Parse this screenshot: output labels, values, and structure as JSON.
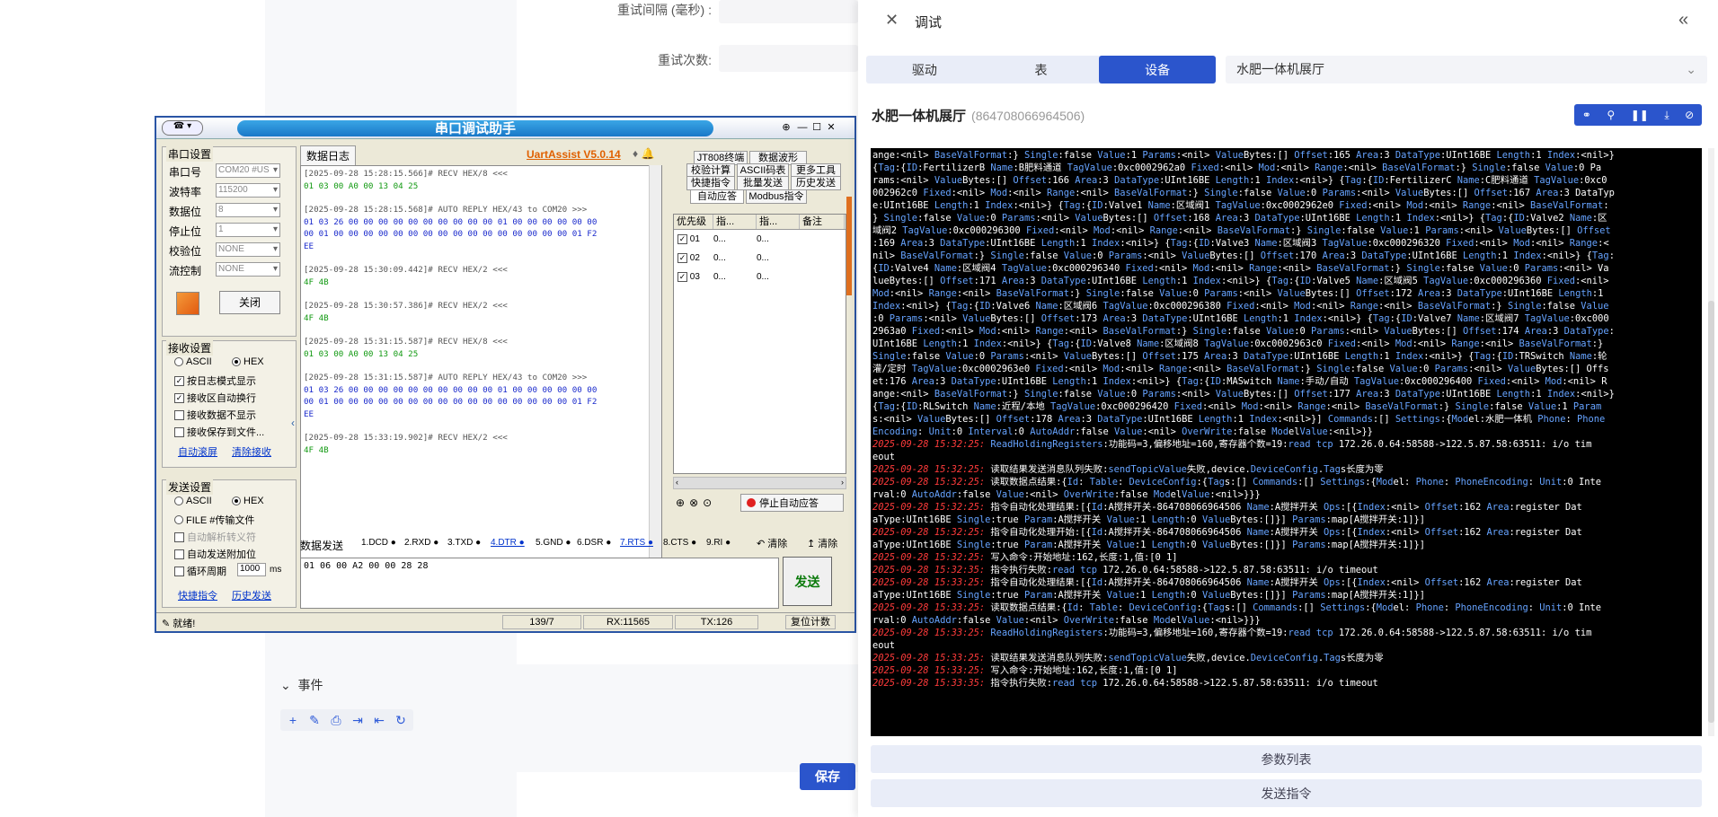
{
  "bg": {
    "retry_interval_label": "重试间隔 (毫秒) :",
    "retry_count_label": "重试次数:",
    "events_title": "事件",
    "save_label": "保存"
  },
  "serial": {
    "title": "串口调试助手",
    "version": "UartAssist V5.0.14",
    "port_group": "串口设置",
    "port_label": "串口号",
    "port_value": "COM20 #US",
    "baud_label": "波特率",
    "baud_value": "115200",
    "databits_label": "数据位",
    "databits_value": "8",
    "stopbits_label": "停止位",
    "stopbits_value": "1",
    "parity_label": "校验位",
    "parity_value": "NONE",
    "flow_label": "流控制",
    "flow_value": "NONE",
    "close_label": "关闭",
    "recv_group": "接收设置",
    "ascii": "ASCII",
    "hex": "HEX",
    "recv_opt1": "按日志模式显示",
    "recv_opt2": "接收区自动换行",
    "recv_opt3": "接收数据不显示",
    "recv_opt4": "接收保存到文件...",
    "auto_scroll": "自动滚屏",
    "clear_recv": "清除接收",
    "send_group": "发送设置",
    "file_send": "FILE #传输文件",
    "auto_parse": "自动解析转义符",
    "send_opt1": "自动发送附加位",
    "send_opt2": "循环周期",
    "period_value": "1000",
    "ms": "ms",
    "quick_cmd": "快捷指令",
    "history_send": "历史发送",
    "log_tab": "数据日志",
    "send_tab": "数据发送",
    "log_lines": [
      {
        "t": "h",
        "s": "[2025-09-28 15:28:15.566]# RECV HEX/8 <<<"
      },
      {
        "t": "g",
        "s": "01 03 00 A0 00 13 04 25"
      },
      {
        "t": "gap",
        "s": ""
      },
      {
        "t": "h",
        "s": "[2025-09-28 15:28:15.568]# AUTO REPLY HEX/43 to COM20 >>>"
      },
      {
        "t": "b",
        "s": "01 03 26 00 00 00 00 00 00 00 00 00 00 01 00 00 00 00 00 00"
      },
      {
        "t": "b",
        "s": "00 01 00 00 00 00 00 00 00 00 00 00 00 00 00 00 00 00 01 F2"
      },
      {
        "t": "b",
        "s": "EE"
      },
      {
        "t": "gap",
        "s": ""
      },
      {
        "t": "h",
        "s": "[2025-09-28 15:30:09.442]# RECV HEX/2 <<<"
      },
      {
        "t": "g",
        "s": "4F 4B"
      },
      {
        "t": "gap",
        "s": ""
      },
      {
        "t": "h",
        "s": "[2025-09-28 15:30:57.386]# RECV HEX/2 <<<"
      },
      {
        "t": "g",
        "s": "4F 4B"
      },
      {
        "t": "gap",
        "s": ""
      },
      {
        "t": "h",
        "s": "[2025-09-28 15:31:15.587]# RECV HEX/8 <<<"
      },
      {
        "t": "g",
        "s": "01 03 00 A0 00 13 04 25"
      },
      {
        "t": "gap",
        "s": ""
      },
      {
        "t": "h",
        "s": "[2025-09-28 15:31:15.587]# AUTO REPLY HEX/43 to COM20 >>>"
      },
      {
        "t": "b",
        "s": "01 03 26 00 00 00 00 00 00 00 00 00 00 01 00 00 00 00 00 00"
      },
      {
        "t": "b",
        "s": "00 01 00 00 00 00 00 00 00 00 00 00 00 00 00 00 00 00 01 F2"
      },
      {
        "t": "b",
        "s": "EE"
      },
      {
        "t": "gap",
        "s": ""
      },
      {
        "t": "h",
        "s": "[2025-09-28 15:33:19.902]# RECV HEX/2 <<<"
      },
      {
        "t": "g",
        "s": "4F 4B"
      }
    ],
    "rtabs": [
      "JT808终端",
      "数据波形",
      "校验计算",
      "ASCII码表",
      "更多工具",
      "快捷指令",
      "批量发送",
      "历史发送",
      "自动应答",
      "Modbus指令"
    ],
    "grid_headers": [
      "优先级",
      "指...",
      "指...",
      "备注"
    ],
    "grid_rows": [
      "01",
      "02",
      "03"
    ],
    "grid_cell": "0...",
    "stop_reply": "停止自动应答",
    "signals": [
      "1.DCD",
      "2.RXD",
      "3.TXD",
      "4.DTR",
      "5.GND",
      "6.DSR",
      "7.RTS",
      "8.CTS",
      "9.RI"
    ],
    "clear1": "清除",
    "clear2": "清除",
    "send_text": "01 06 00 A2 00 00 28 28",
    "send_btn": "发送",
    "status_ready": "就绪!",
    "status_pos": "139/7",
    "status_rx": "RX:11565",
    "status_tx": "TX:126",
    "reset_count": "复位计数"
  },
  "panel": {
    "title": "调试",
    "tabs": [
      "驱动",
      "表",
      "设备"
    ],
    "device_select": "水肥一体机展厅",
    "device_name": "水肥一体机展厅",
    "device_id": "864708066964506",
    "params_btn": "参数列表",
    "send_btn": "发送指令",
    "term_lines": [
      "ange:<nil> BaseValFormat:} Single:false Value:1 Params:<nil> ValueBytes:[] Offset:165 Area:3 DataType:UInt16BE Length:1 Index:<nil>}",
      " {Tag:{ID:FertilizerB Name:B肥料通道 TagValue:0xc0002962a0 Fixed:<nil> Mod:<nil> Range:<nil> BaseValFormat:} Single:false Value:0 Pa",
      "rams:<nil> ValueBytes:[] Offset:166 Area:3 DataType:UInt16BE Length:1 Index:<nil>} {Tag:{ID:FertilizerC Name:C肥料通道 TagValue:0xc0",
      "002962c0 Fixed:<nil> Mod:<nil> Range:<nil> BaseValFormat:} Single:false Value:0 Params:<nil> ValueBytes:[] Offset:167 Area:3 DataTyp",
      "e:UInt16BE Length:1 Index:<nil>} {Tag:{ID:Valve1 Name:区域阀1 TagValue:0xc0002962e0 Fixed:<nil> Mod:<nil> Range:<nil> BaseValFormat:",
      "} Single:false Value:0 Params:<nil> ValueBytes:[] Offset:168 Area:3 DataType:UInt16BE Length:1 Index:<nil>} {Tag:{ID:Valve2 Name:区",
      "域阀2 TagValue:0xc000296300 Fixed:<nil> Mod:<nil> Range:<nil> BaseValFormat:} Single:false Value:1 Params:<nil> ValueBytes:[] Offset",
      ":169 Area:3 DataType:UInt16BE Length:1 Index:<nil>} {Tag:{ID:Valve3 Name:区域阀3 TagValue:0xc000296320 Fixed:<nil> Mod:<nil> Range:<",
      "nil> BaseValFormat:} Single:false Value:0 Params:<nil> ValueBytes:[] Offset:170 Area:3 DataType:UInt16BE Length:1 Index:<nil>} {Tag:",
      "{ID:Valve4 Name:区域阀4 TagValue:0xc000296340 Fixed:<nil> Mod:<nil> Range:<nil> BaseValFormat:} Single:false Value:0 Params:<nil> Va",
      "lueBytes:[] Offset:171 Area:3 DataType:UInt16BE Length:1 Index:<nil>} {Tag:{ID:Valve5 Name:区域阀5 TagValue:0xc000296360 Fixed:<nil>",
      " Mod:<nil> Range:<nil> BaseValFormat:} Single:false Value:0 Params:<nil> ValueBytes:[] Offset:172 Area:3 DataType:UInt16BE Length:1",
      " Index:<nil>} {Tag:{ID:Valve6 Name:区域阀6 TagValue:0xc000296380 Fixed:<nil> Mod:<nil> Range:<nil> BaseValFormat:} Single:false Value",
      ":0 Params:<nil> ValueBytes:[] Offset:173 Area:3 DataType:UInt16BE Length:1 Index:<nil>} {Tag:{ID:Valve7 Name:区域阀7 TagValue:0xc000",
      "2963a0 Fixed:<nil> Mod:<nil> Range:<nil> BaseValFormat:} Single:false Value:0 Params:<nil> ValueBytes:[] Offset:174 Area:3 DataType:",
      "UInt16BE Length:1 Index:<nil>} {Tag:{ID:Valve8 Name:区域阀8 TagValue:0xc0002963c0 Fixed:<nil> Mod:<nil> Range:<nil> BaseValFormat:}",
      " Single:false Value:0 Params:<nil> ValueBytes:[] Offset:175 Area:3 DataType:UInt16BE Length:1 Index:<nil>} {Tag:{ID:TRSwitch Name:轮",
      "灌/定时 TagValue:0xc0002963e0 Fixed:<nil> Mod:<nil> Range:<nil> BaseValFormat:} Single:false Value:0 Params:<nil> ValueBytes:[] Offs",
      "et:176 Area:3 DataType:UInt16BE Length:1 Index:<nil>} {Tag:{ID:MASwitch Name:手动/自动 TagValue:0xc000296400 Fixed:<nil> Mod:<nil> R",
      "ange:<nil> BaseValFormat:} Single:false Value:0 Params:<nil> ValueBytes:[] Offset:177 Area:3 DataType:UInt16BE Length:1 Index:<nil>}",
      " {Tag:{ID:RLSwitch Name:近程/本地 TagValue:0xc000296420 Fixed:<nil> Mod:<nil> Range:<nil> BaseValFormat:} Single:false Value:1 Param",
      "s:<nil> ValueBytes:[] Offset:178 Area:3 DataType:UInt16BE Length:1 Index:<nil>}] Commands:[] Settings:{Model:水肥一体机 Phone: Phone",
      "Encoding: Unit:0 Interval:0 AutoAddr:false Value:<nil> OverWrite:false ModelValue:<nil>}}",
      "@2025-09-28 15:32:25: ReadHoldingRegisters:功能码=3,偏移地址=160,寄存器个数=19:read tcp 172.26.0.64:58588->122.5.87.58:63511: i/o tim",
      "eout",
      "@2025-09-28 15:32:25: 读取结果发送消息队列失败:sendTopicValue失败,device.DeviceConfig.Tags长度为零",
      "@2025-09-28 15:32:25: 读取数据点结果:{Id: Table: DeviceConfig:{Tags:[] Commands:[] Settings:{Model: Phone: PhoneEncoding: Unit:0 Inte",
      "rval:0 AutoAddr:false Value:<nil> OverWrite:false ModelValue:<nil>}}}",
      "@2025-09-28 15:32:25: 指令自动化处理结果:[{Id:A搅拌开关-864708066964506 Name:A搅拌开关 Ops:[{Index:<nil> Offset:162 Area:register Dat",
      "aType:UInt16BE Single:true Param:A搅拌开关 Value:1 Length:0 ValueBytes:[]}] Params:map[A搅拌开关:1]}]",
      "@2025-09-28 15:32:25: 指令自动化处理开始:[{Id:A搅拌开关-864708066964506 Name:A搅拌开关 Ops:[{Index:<nil> Offset:162 Area:register Dat",
      "aType:UInt16BE Single:true Param:A搅拌开关 Value:1 Length:0 ValueBytes:[]}] Params:map[A搅拌开关:1]}]",
      "@2025-09-28 15:32:25: 写入命令:开始地址:162,长度:1,值:[0 1]",
      "@2025-09-28 15:32:35: 指令执行失败:read tcp 172.26.0.64:58588->122.5.87.58:63511: i/o timeout",
      "@2025-09-28 15:33:25: 指令自动化处理结果:[{Id:A搅拌开关-864708066964506 Name:A搅拌开关 Ops:[{Index:<nil> Offset:162 Area:register Dat",
      "aType:UInt16BE Single:true Param:A搅拌开关 Value:1 Length:0 ValueBytes:[]}] Params:map[A搅拌开关:1]}]",
      "@2025-09-28 15:33:25: 读取数据点结果:{Id: Table: DeviceConfig:{Tags:[] Commands:[] Settings:{Model: Phone: PhoneEncoding: Unit:0 Inte",
      "rval:0 AutoAddr:false Value:<nil> OverWrite:false ModelValue:<nil>}}}",
      "@2025-09-28 15:33:25: ReadHoldingRegisters:功能码=3,偏移地址=160,寄存器个数=19:read tcp 172.26.0.64:58588->122.5.87.58:63511: i/o tim",
      "eout",
      "@2025-09-28 15:33:25: 读取结果发送消息队列失败:sendTopicValue失败,device.DeviceConfig.Tags长度为零",
      "@2025-09-28 15:33:25: 写入命令:开始地址:162,长度:1,值:[0 1]",
      "@2025-09-28 15:33:35: 指令执行失败:read tcp 172.26.0.64:58588->122.5.87.58:63511: i/o timeout"
    ]
  }
}
